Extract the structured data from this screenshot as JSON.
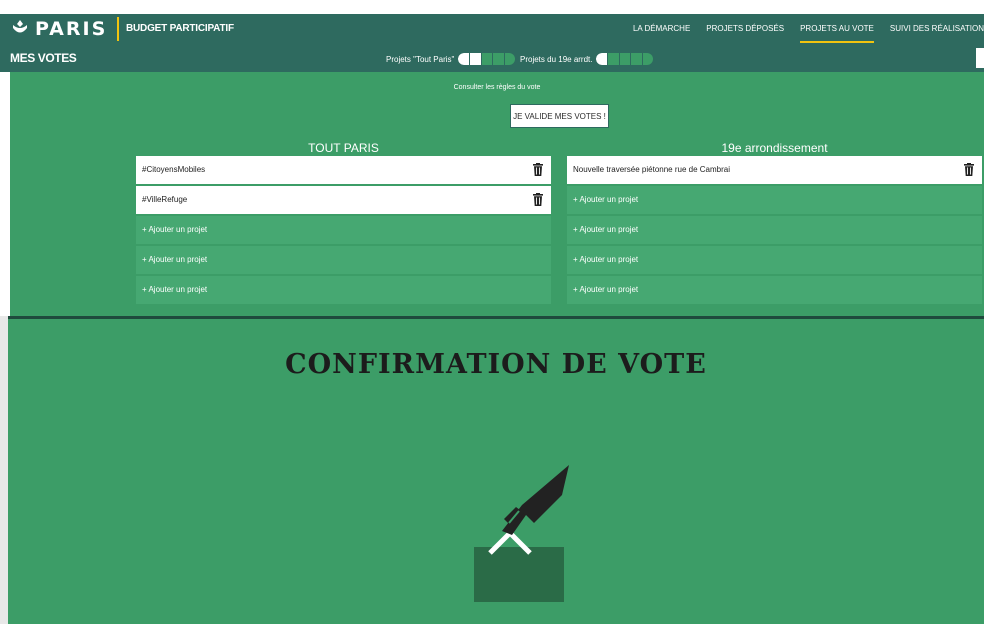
{
  "header": {
    "logo_text": "PARIS",
    "brand": "BUDGET PARTICIPATIF",
    "nav": [
      {
        "label": "LA DÉMARCHE",
        "active": false
      },
      {
        "label": "PROJETS DÉPOSÉS",
        "active": false
      },
      {
        "label": "PROJETS AU VOTE",
        "active": true
      },
      {
        "label": "SUIVI DES RÉALISATION",
        "active": false
      }
    ]
  },
  "votes_bar": {
    "title": "MES VOTES",
    "toggle_paris_label": "Projets \"Tout Paris\"",
    "toggle_paris_filled": 2,
    "toggle_arr_label": "Projets du 19e arrdt.",
    "toggle_arr_filled": 1
  },
  "main": {
    "rules_link": "Consulter les règles du vote",
    "validate_button": "JE VALIDE MES VOTES !",
    "columns": [
      {
        "title": "TOUT PARIS",
        "slots": [
          {
            "text": "#CitoyensMobiles",
            "filled": true
          },
          {
            "text": "#VilleRefuge",
            "filled": true
          },
          {
            "text": "+ Ajouter un projet",
            "filled": false
          },
          {
            "text": "+ Ajouter un projet",
            "filled": false
          },
          {
            "text": "+ Ajouter un projet",
            "filled": false
          }
        ]
      },
      {
        "title": "19e arrondissement",
        "slots": [
          {
            "text": "Nouvelle traversée piétonne rue de Cambrai",
            "filled": true
          },
          {
            "text": "+ Ajouter un projet",
            "filled": false
          },
          {
            "text": "+ Ajouter un projet",
            "filled": false
          },
          {
            "text": "+ Ajouter un projet",
            "filled": false
          },
          {
            "text": "+ Ajouter un projet",
            "filled": false
          }
        ]
      }
    ]
  },
  "modal": {
    "title": "CONFIRMATION DE VOTE",
    "icon": "ballot-box-icon"
  },
  "colors": {
    "dark_green": "#2e6a5f",
    "green": "#3c9d67",
    "accent": "#f1c40f"
  }
}
